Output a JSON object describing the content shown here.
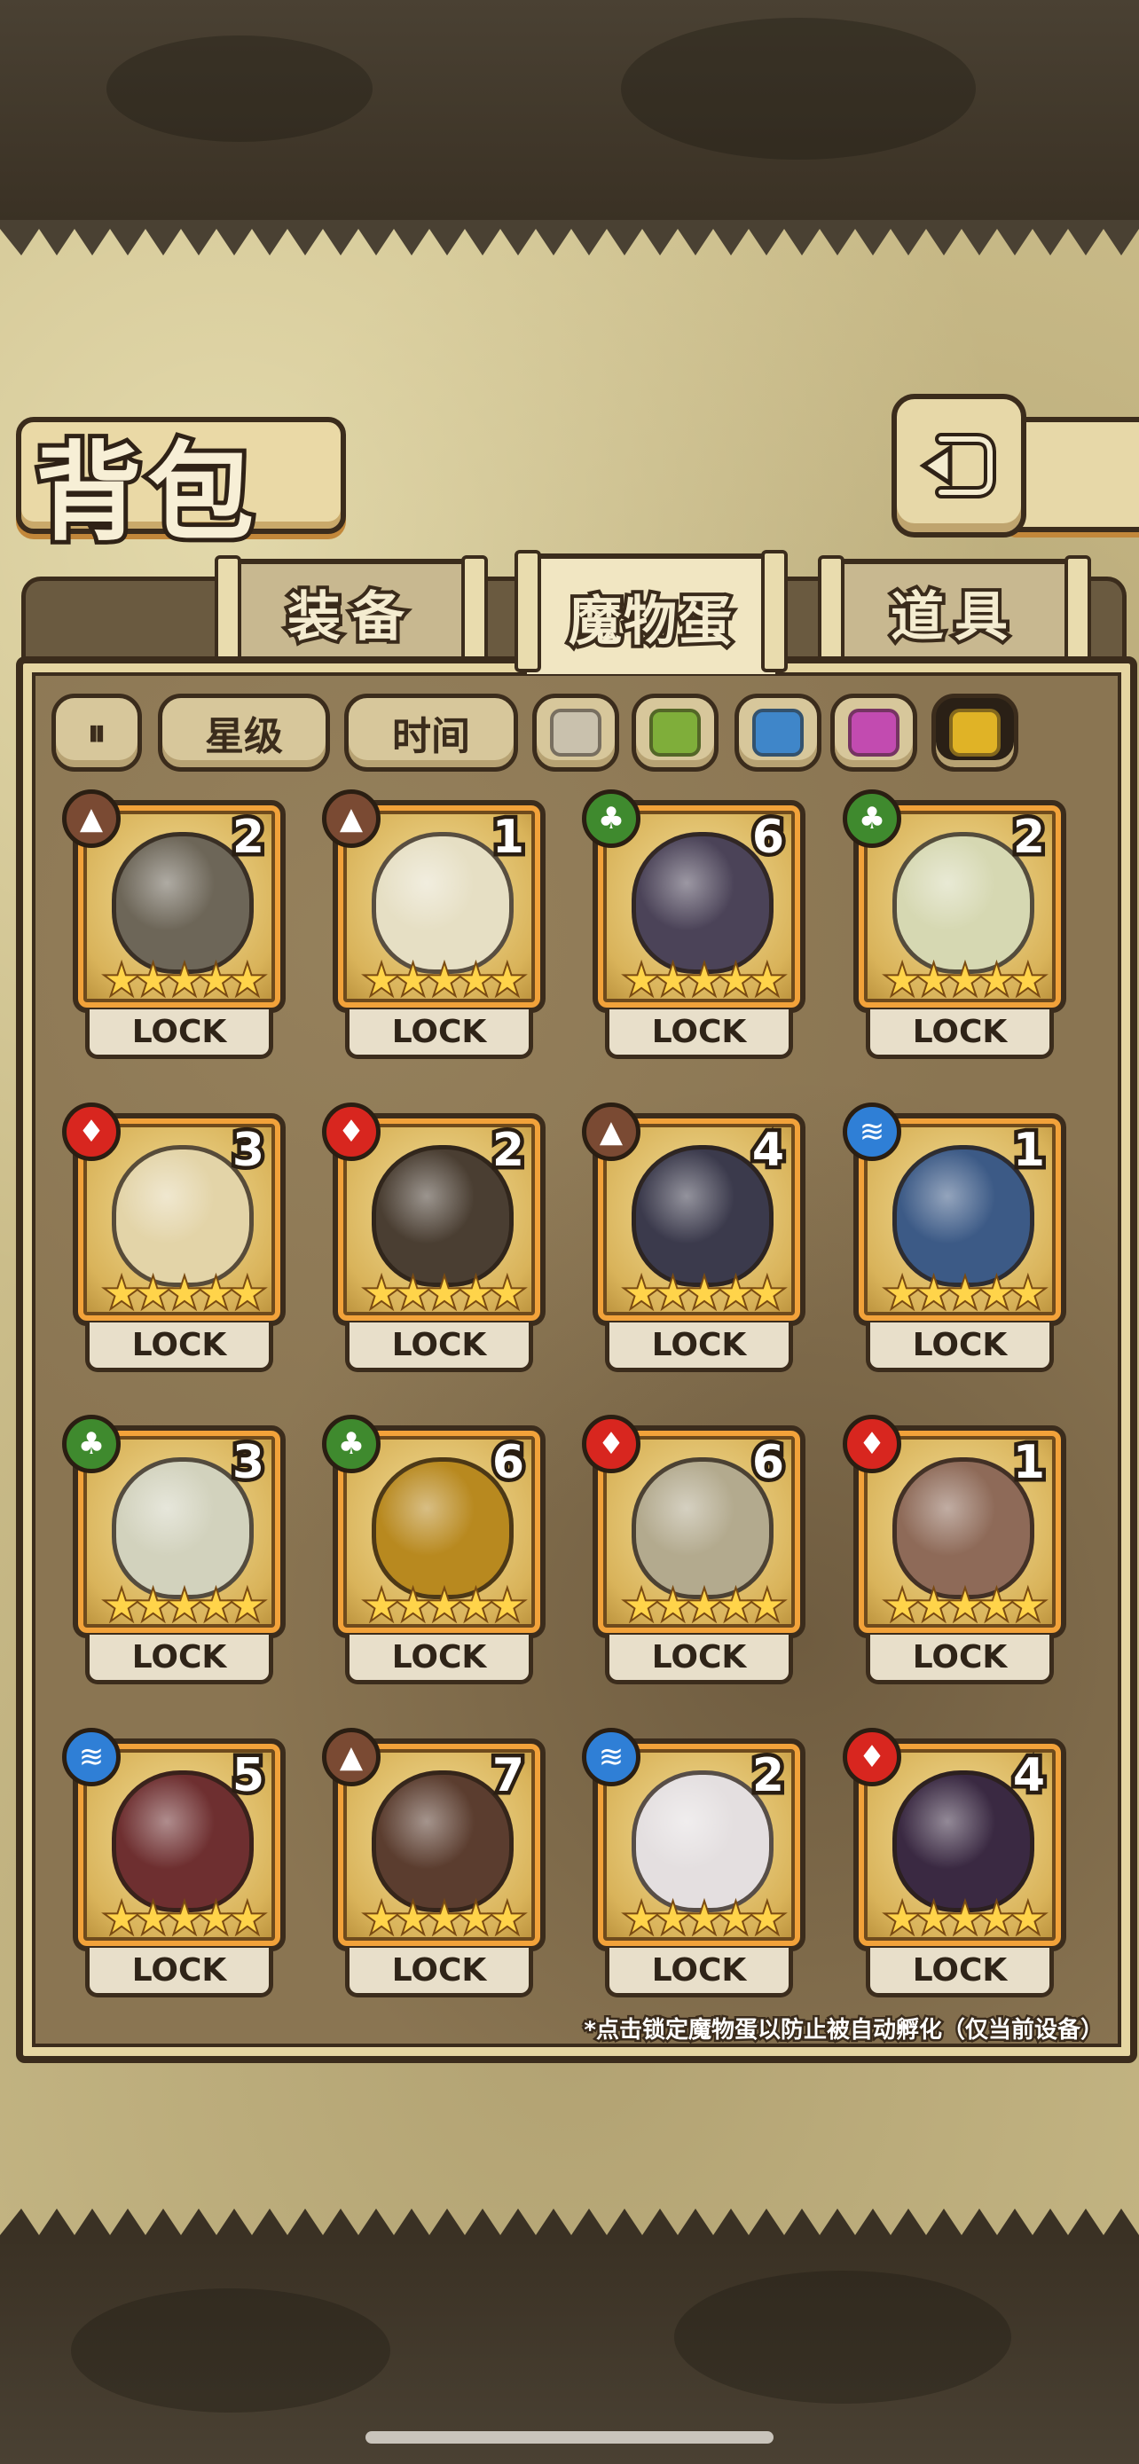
{
  "title": "背包",
  "tabs": [
    {
      "label": "装备",
      "active": false
    },
    {
      "label": "魔物蛋",
      "active": true
    },
    {
      "label": "道具",
      "active": false
    }
  ],
  "filters": {
    "sort_star": "星级",
    "sort_time": "时间",
    "colors": [
      "#c9c1ad",
      "#7fae3a",
      "#3f86c9",
      "#c24bb0",
      "#e0b326"
    ],
    "selected_color_index": 4
  },
  "lock_label": "LOCK",
  "element_colors": {
    "earth": "#7a4a33",
    "grass": "#3f8a2e",
    "fire": "#d8261f",
    "water": "#2f7fd6"
  },
  "eggs": [
    {
      "element": "earth",
      "count": "2",
      "stars": 5,
      "color": "#6d6658"
    },
    {
      "element": "earth",
      "count": "1",
      "stars": 5,
      "color": "#e6dfc4"
    },
    {
      "element": "grass",
      "count": "6",
      "stars": 5,
      "color": "#4b4358"
    },
    {
      "element": "grass",
      "count": "2",
      "stars": 5,
      "color": "#d6d8b2"
    },
    {
      "element": "fire",
      "count": "3",
      "stars": 5,
      "color": "#e3d4a8"
    },
    {
      "element": "fire",
      "count": "2",
      "stars": 5,
      "color": "#4a3e32"
    },
    {
      "element": "earth",
      "count": "4",
      "stars": 5,
      "color": "#3b3a4c"
    },
    {
      "element": "water",
      "count": "1",
      "stars": 5,
      "color": "#3c5a86"
    },
    {
      "element": "grass",
      "count": "3",
      "stars": 5,
      "color": "#d2d2bd"
    },
    {
      "element": "grass",
      "count": "6",
      "stars": 5,
      "color": "#b8891f"
    },
    {
      "element": "fire",
      "count": "6",
      "stars": 5,
      "color": "#b3aa8e"
    },
    {
      "element": "fire",
      "count": "1",
      "stars": 5,
      "color": "#8e6a58"
    },
    {
      "element": "water",
      "count": "5",
      "stars": 5,
      "color": "#6e2f30"
    },
    {
      "element": "earth",
      "count": "7",
      "stars": 5,
      "color": "#5b3d2f"
    },
    {
      "element": "water",
      "count": "2",
      "stars": 5,
      "color": "#e4dfe0"
    },
    {
      "element": "fire",
      "count": "4",
      "stars": 5,
      "color": "#3a2942"
    }
  ],
  "hint": "*点击锁定魔物蛋以防止被自动孵化（仅当前设备）"
}
